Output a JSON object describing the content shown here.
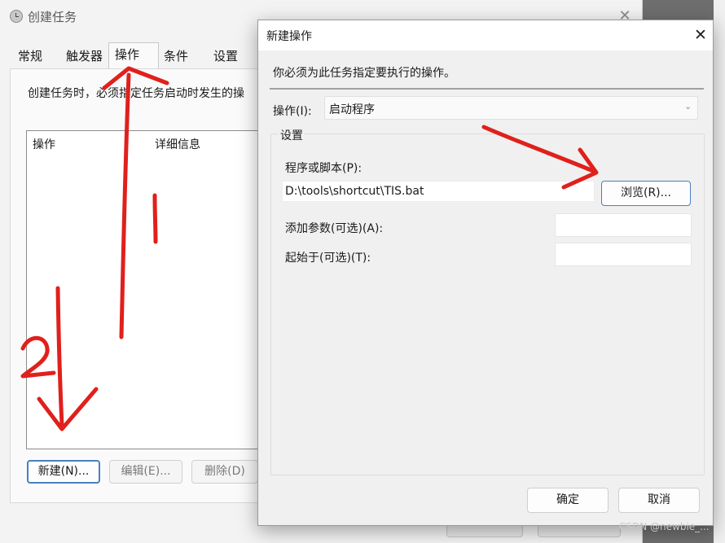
{
  "background_window": {
    "title": "创建任务",
    "close_glyph": "✕",
    "tabs": [
      "常规",
      "触发器",
      "操作",
      "条件",
      "设置"
    ],
    "description": "创建任务时，必须指定任务启动时发生的操",
    "columns": {
      "action": "操作",
      "details": "详细信息"
    },
    "buttons": {
      "new": "新建(N)...",
      "edit": "编辑(E)...",
      "delete": "删除(D)"
    }
  },
  "dialog": {
    "title": "新建操作",
    "close_glyph": "✕",
    "message": "你必须为此任务指定要执行的操作。",
    "action_label": "操作(I):",
    "action_value": "启动程序",
    "settings_group": "设置",
    "program_label": "程序或脚本(P):",
    "program_value": "D:\\tools\\shortcut\\TIS.bat",
    "browse_button": "浏览(R)...",
    "arguments_label": "添加参数(可选)(A):",
    "arguments_value": "",
    "start_in_label": "起始于(可选)(T):",
    "start_in_value": "",
    "ok_button": "确定",
    "cancel_button": "取消"
  },
  "annotations": {
    "step1": "1",
    "step2": "2",
    "color": "#e0201c"
  },
  "watermark": "CSDN @newbie_..."
}
